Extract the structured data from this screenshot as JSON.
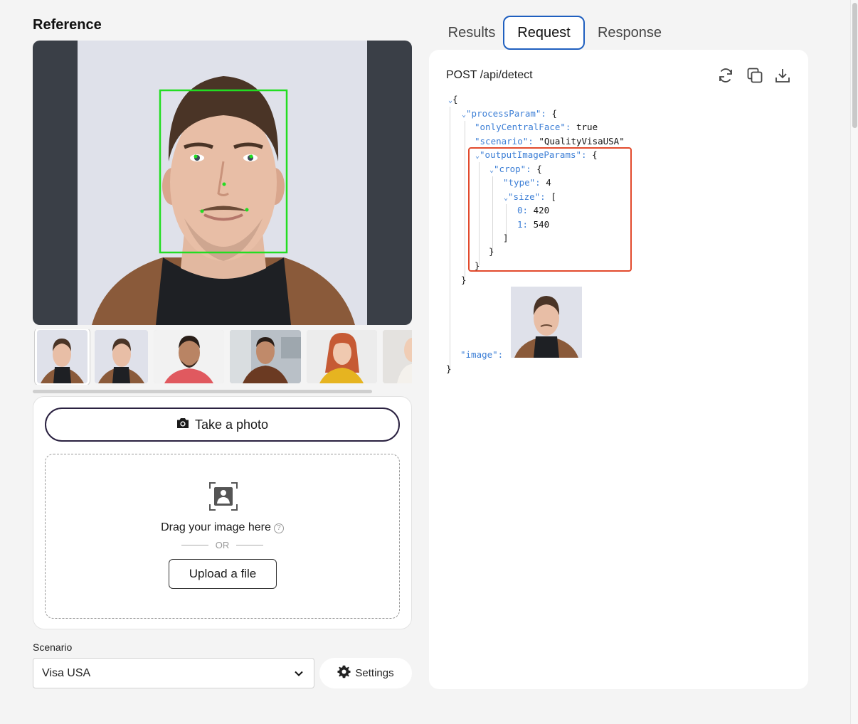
{
  "reference": {
    "title": "Reference"
  },
  "upload": {
    "take_photo_label": "Take a photo",
    "drag_text": "Drag your image here",
    "help_glyph": "?",
    "or_label": "OR",
    "upload_label": "Upload a file"
  },
  "scenario": {
    "label": "Scenario",
    "selected": "Visa USA",
    "settings_label": "Settings"
  },
  "tabs": [
    {
      "label": "Results",
      "active": false
    },
    {
      "label": "Request",
      "active": true
    },
    {
      "label": "Response",
      "active": false
    }
  ],
  "request": {
    "endpoint": "POST /api/detect",
    "toolbar_icons": [
      "refresh-icon",
      "copy-icon",
      "download-icon"
    ],
    "json": {
      "open_brace": "{",
      "close_brace": "}",
      "process_param_key": "\"processParam\":",
      "only_central_face_key": "\"onlyCentralFace\":",
      "only_central_face_val": "true",
      "scenario_key": "\"scenario\":",
      "scenario_val": "\"QualityVisaUSA\"",
      "output_image_params_key": "\"outputImageParams\":",
      "crop_key": "\"crop\":",
      "type_key": "\"type\":",
      "type_val": "4",
      "size_key": "\"size\":",
      "open_bracket": "[",
      "close_bracket": "]",
      "size_0_key": "0:",
      "size_0_val": "420",
      "size_1_key": "1:",
      "size_1_val": "540",
      "image_key": "\"image\":"
    }
  },
  "colors": {
    "accent_tab_border": "#1f5fbf",
    "json_key": "#3d7fd6",
    "highlight_box": "#e24a2c",
    "face_box": "#22dd22"
  }
}
